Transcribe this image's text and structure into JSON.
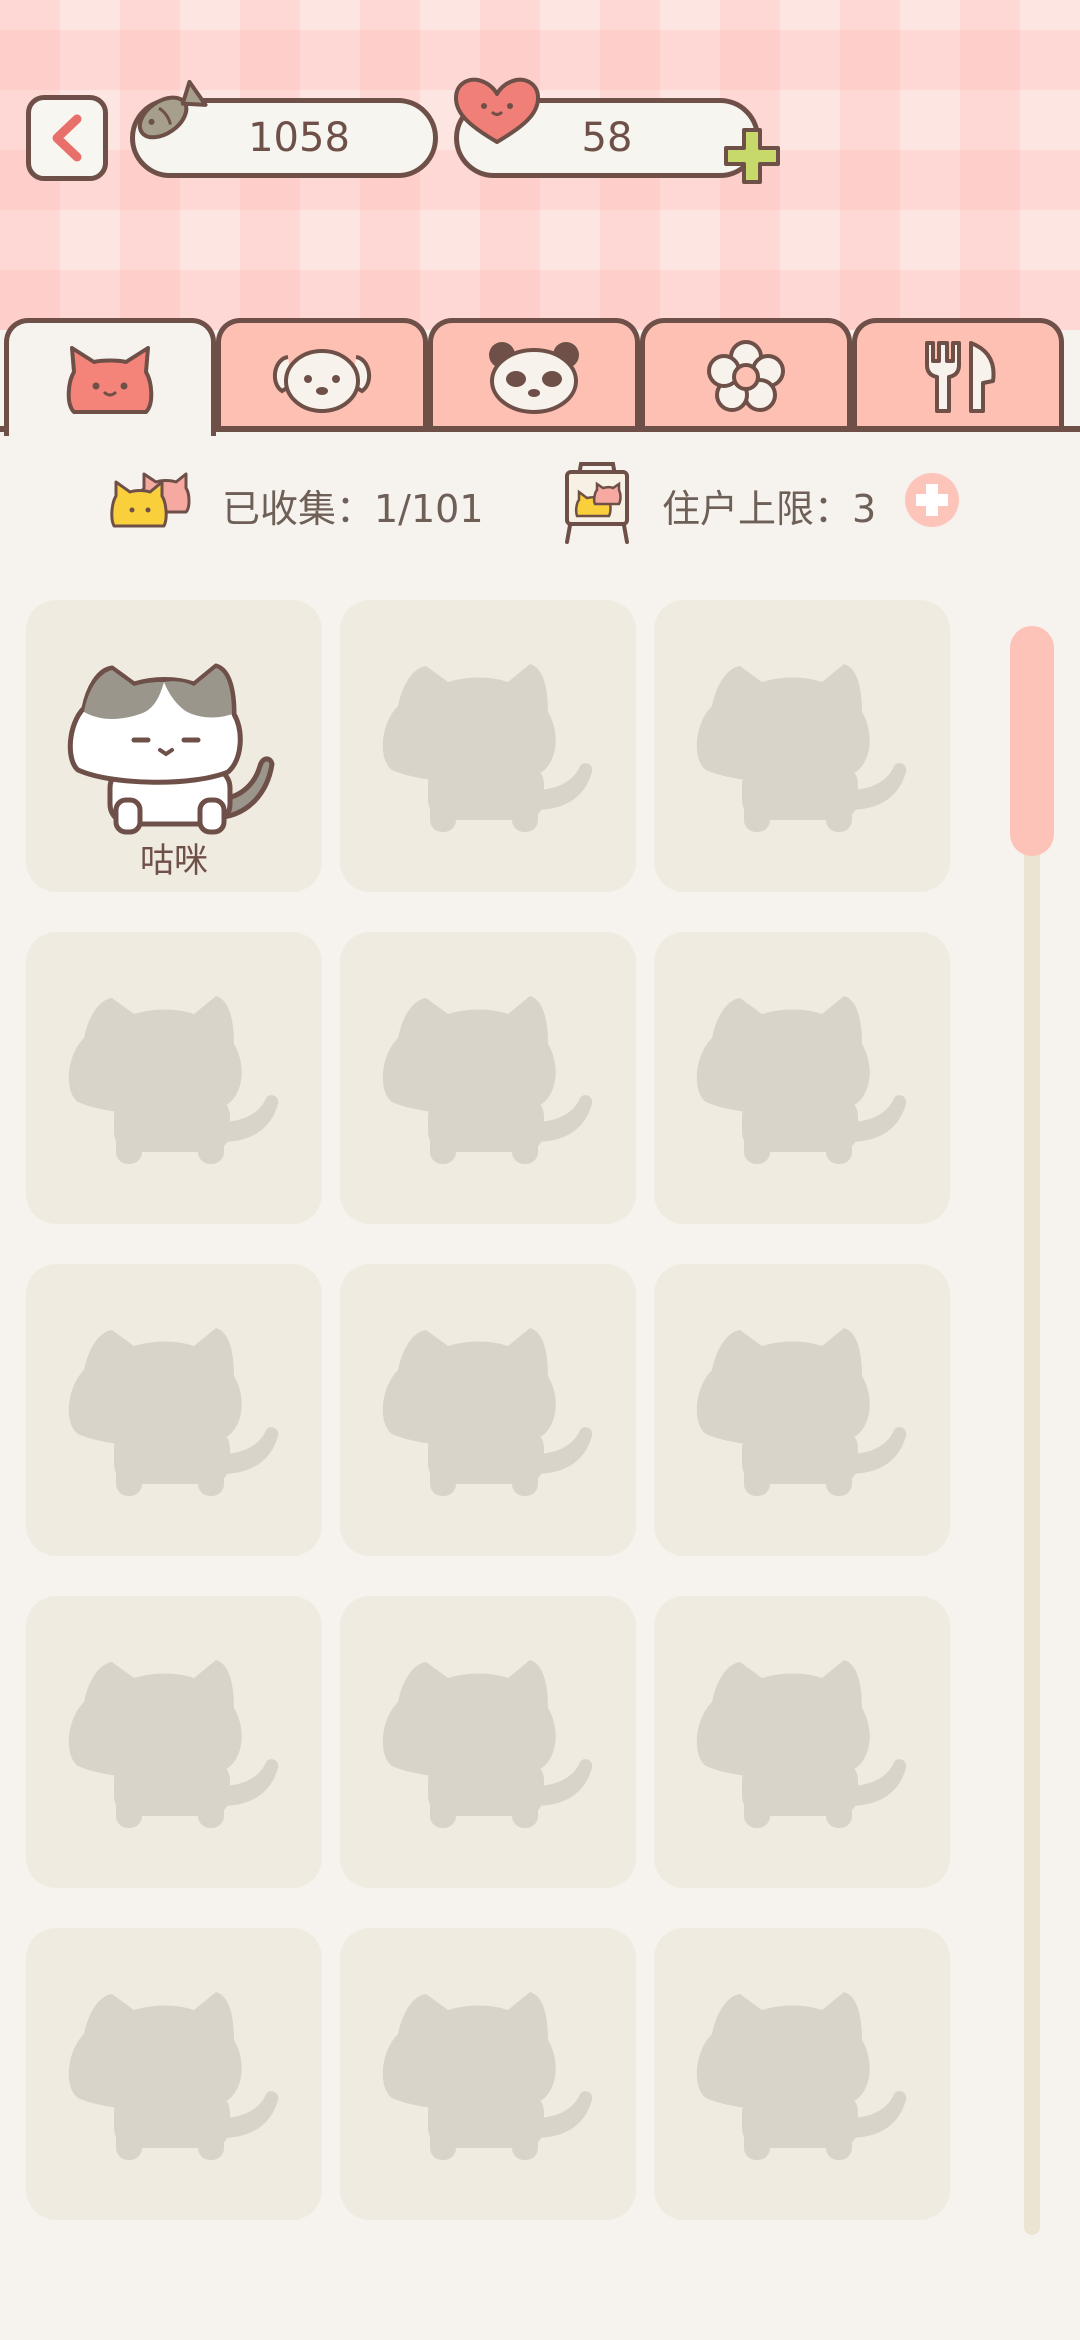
{
  "header": {
    "fish_count": "1058",
    "heart_count": "58"
  },
  "tabs": [
    {
      "name": "tab-cats",
      "icon": "cat-face-icon",
      "active": true
    },
    {
      "name": "tab-dogs",
      "icon": "dog-face-icon",
      "active": false
    },
    {
      "name": "tab-pandas",
      "icon": "panda-face-icon",
      "active": false
    },
    {
      "name": "tab-flowers",
      "icon": "flower-icon",
      "active": false
    },
    {
      "name": "tab-food",
      "icon": "fork-knife-icon",
      "active": false
    }
  ],
  "stats": {
    "collected_label": "已收集：1/101",
    "resident_limit_label": "住户上限：3"
  },
  "cats": [
    {
      "name": "咕咪",
      "unlocked": true
    },
    {
      "unlocked": false
    },
    {
      "unlocked": false
    },
    {
      "unlocked": false
    },
    {
      "unlocked": false
    },
    {
      "unlocked": false
    },
    {
      "unlocked": false
    },
    {
      "unlocked": false
    },
    {
      "unlocked": false
    },
    {
      "unlocked": false
    },
    {
      "unlocked": false
    },
    {
      "unlocked": false
    },
    {
      "unlocked": false
    },
    {
      "unlocked": false
    },
    {
      "unlocked": false
    }
  ],
  "colors": {
    "outline": "#6e5048",
    "tab_inactive": "#fec0b3",
    "silhouette": "#d9d4ca",
    "plus_green": "#c6d96a",
    "scroll_thumb": "#fec3b8"
  }
}
